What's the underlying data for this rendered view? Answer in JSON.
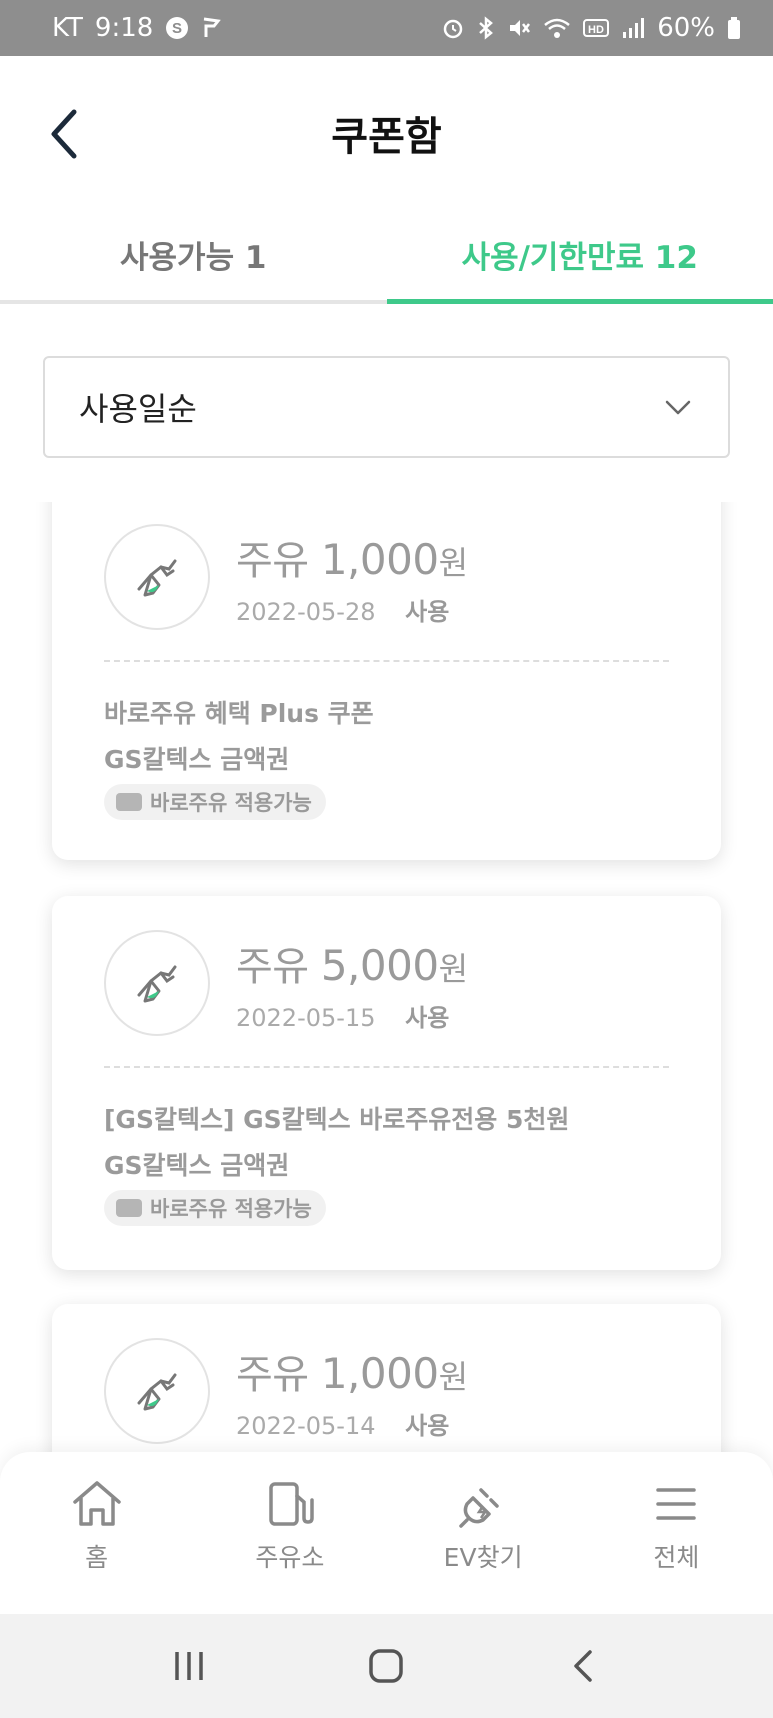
{
  "status_bar": {
    "carrier": "KT",
    "time": "9:18",
    "battery": "60%"
  },
  "header": {
    "title": "쿠폰함"
  },
  "tabs": [
    {
      "label": "사용가능 1",
      "active": false
    },
    {
      "label": "사용/기한만료 12",
      "active": true
    }
  ],
  "sort": {
    "selected": "사용일순"
  },
  "coupons": [
    {
      "amount_prefix": "주유",
      "amount": "1,000",
      "currency": "원",
      "date": "2022-05-28",
      "state": "사용",
      "name": "바로주유 혜택 Plus 쿠폰",
      "type": "GS칼텍스 금액권",
      "badge": "바로주유 적용가능"
    },
    {
      "amount_prefix": "주유",
      "amount": "5,000",
      "currency": "원",
      "date": "2022-05-15",
      "state": "사용",
      "name": "[GS칼텍스] GS칼텍스 바로주유전용 5천원",
      "type": "GS칼텍스 금액권",
      "badge": "바로주유 적용가능"
    },
    {
      "amount_prefix": "주유",
      "amount": "1,000",
      "currency": "원",
      "date": "2022-05-14",
      "state": "사용"
    }
  ],
  "bottom_nav": [
    {
      "label": "홈",
      "icon": "home-icon"
    },
    {
      "label": "주유소",
      "icon": "gas-station-icon"
    },
    {
      "label": "EV찾기",
      "icon": "ev-plug-icon"
    },
    {
      "label": "전체",
      "icon": "menu-icon"
    }
  ],
  "colors": {
    "accent": "#3ec98a",
    "statusbar": "#8e8e8e",
    "muted_text": "#9a9a9a"
  }
}
